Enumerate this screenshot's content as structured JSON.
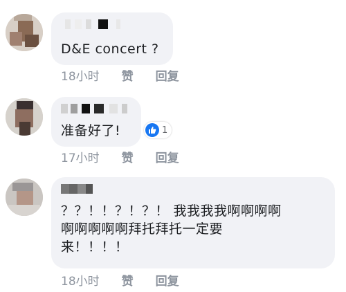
{
  "comments": [
    {
      "text": "D&E concert ?",
      "time": "18小时",
      "like_label": "赞",
      "reply_label": "回复"
    },
    {
      "text": "准备好了!",
      "time": "17小时",
      "like_label": "赞",
      "reply_label": "回复",
      "reaction": {
        "icon": "thumbs-up-icon",
        "count": "1",
        "color": "#1877f2"
      }
    },
    {
      "text": "？？！！？！？！ 我我我我啊啊啊啊\n啊啊啊啊啊拜托拜托一定要\n来！！！！",
      "time": "18小时",
      "like_label": "赞",
      "reply_label": "回复"
    }
  ],
  "colors": {
    "bubble_bg": "#f1f2f6",
    "text": "#1c1e21",
    "meta": "#8d949e",
    "accent": "#1877f2"
  }
}
